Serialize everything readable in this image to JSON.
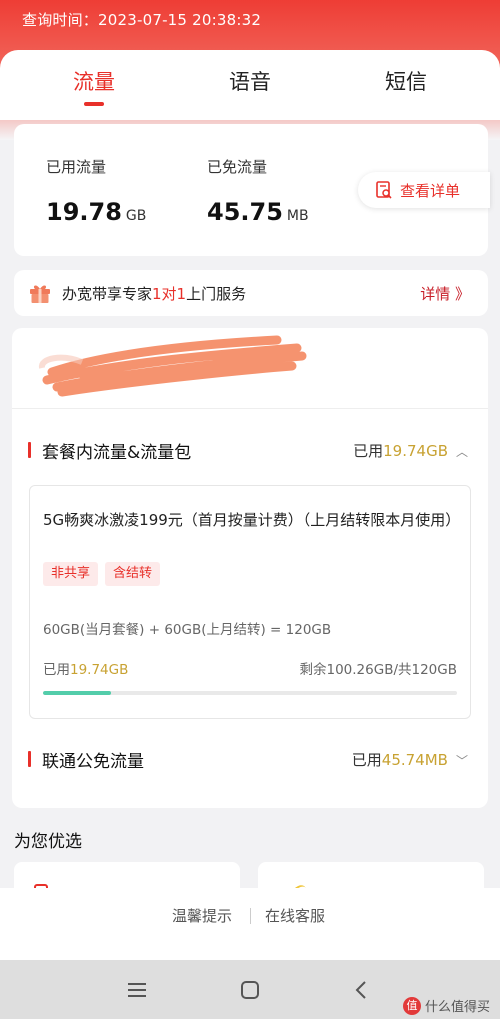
{
  "header": {
    "query_time": "查询时间：2023-07-15 20:38:32"
  },
  "tabs": [
    {
      "label": "流量",
      "active": true
    },
    {
      "label": "语音",
      "active": false
    },
    {
      "label": "短信",
      "active": false
    }
  ],
  "usage": {
    "used_label": "已用流量",
    "used_value": "19.78",
    "used_unit": "GB",
    "free_label": "已免流量",
    "free_value": "45.75",
    "free_unit": "MB",
    "detail_button": "查看详单"
  },
  "promo": {
    "text_before": "办宽带享专家",
    "text_highlight": "1对1",
    "text_after": "上门服务",
    "link": "详情 》"
  },
  "package_section": {
    "title": "套餐内流量&流量包",
    "used_prefix": "已用",
    "used_value": "19.74GB",
    "chevron": "^"
  },
  "package": {
    "name": "5G畅爽冰激凌199元（首月按量计费）（上月结转限本月使用）",
    "tags": [
      "非共享",
      "含结转"
    ],
    "formula": "60GB(当月套餐) + 60GB(上月结转) = 120GB",
    "used_prefix": "已用",
    "used_value": "19.74GB",
    "remaining": "剩余100.26GB/共120GB",
    "progress_fraction": 0.1645
  },
  "free_section": {
    "title": "联通公免流量",
    "used_prefix": "已用",
    "used_value": "45.74MB",
    "chevron": "v"
  },
  "recommend": {
    "title": "为您优选"
  },
  "footer": {
    "tips": "温馨提示",
    "service": "在线客服"
  },
  "watermark": {
    "badge": "值",
    "text": "什么值得买"
  },
  "colors": {
    "brand_red": "#e8302a",
    "gold": "#c8a232",
    "progress": "#53cdaa"
  }
}
